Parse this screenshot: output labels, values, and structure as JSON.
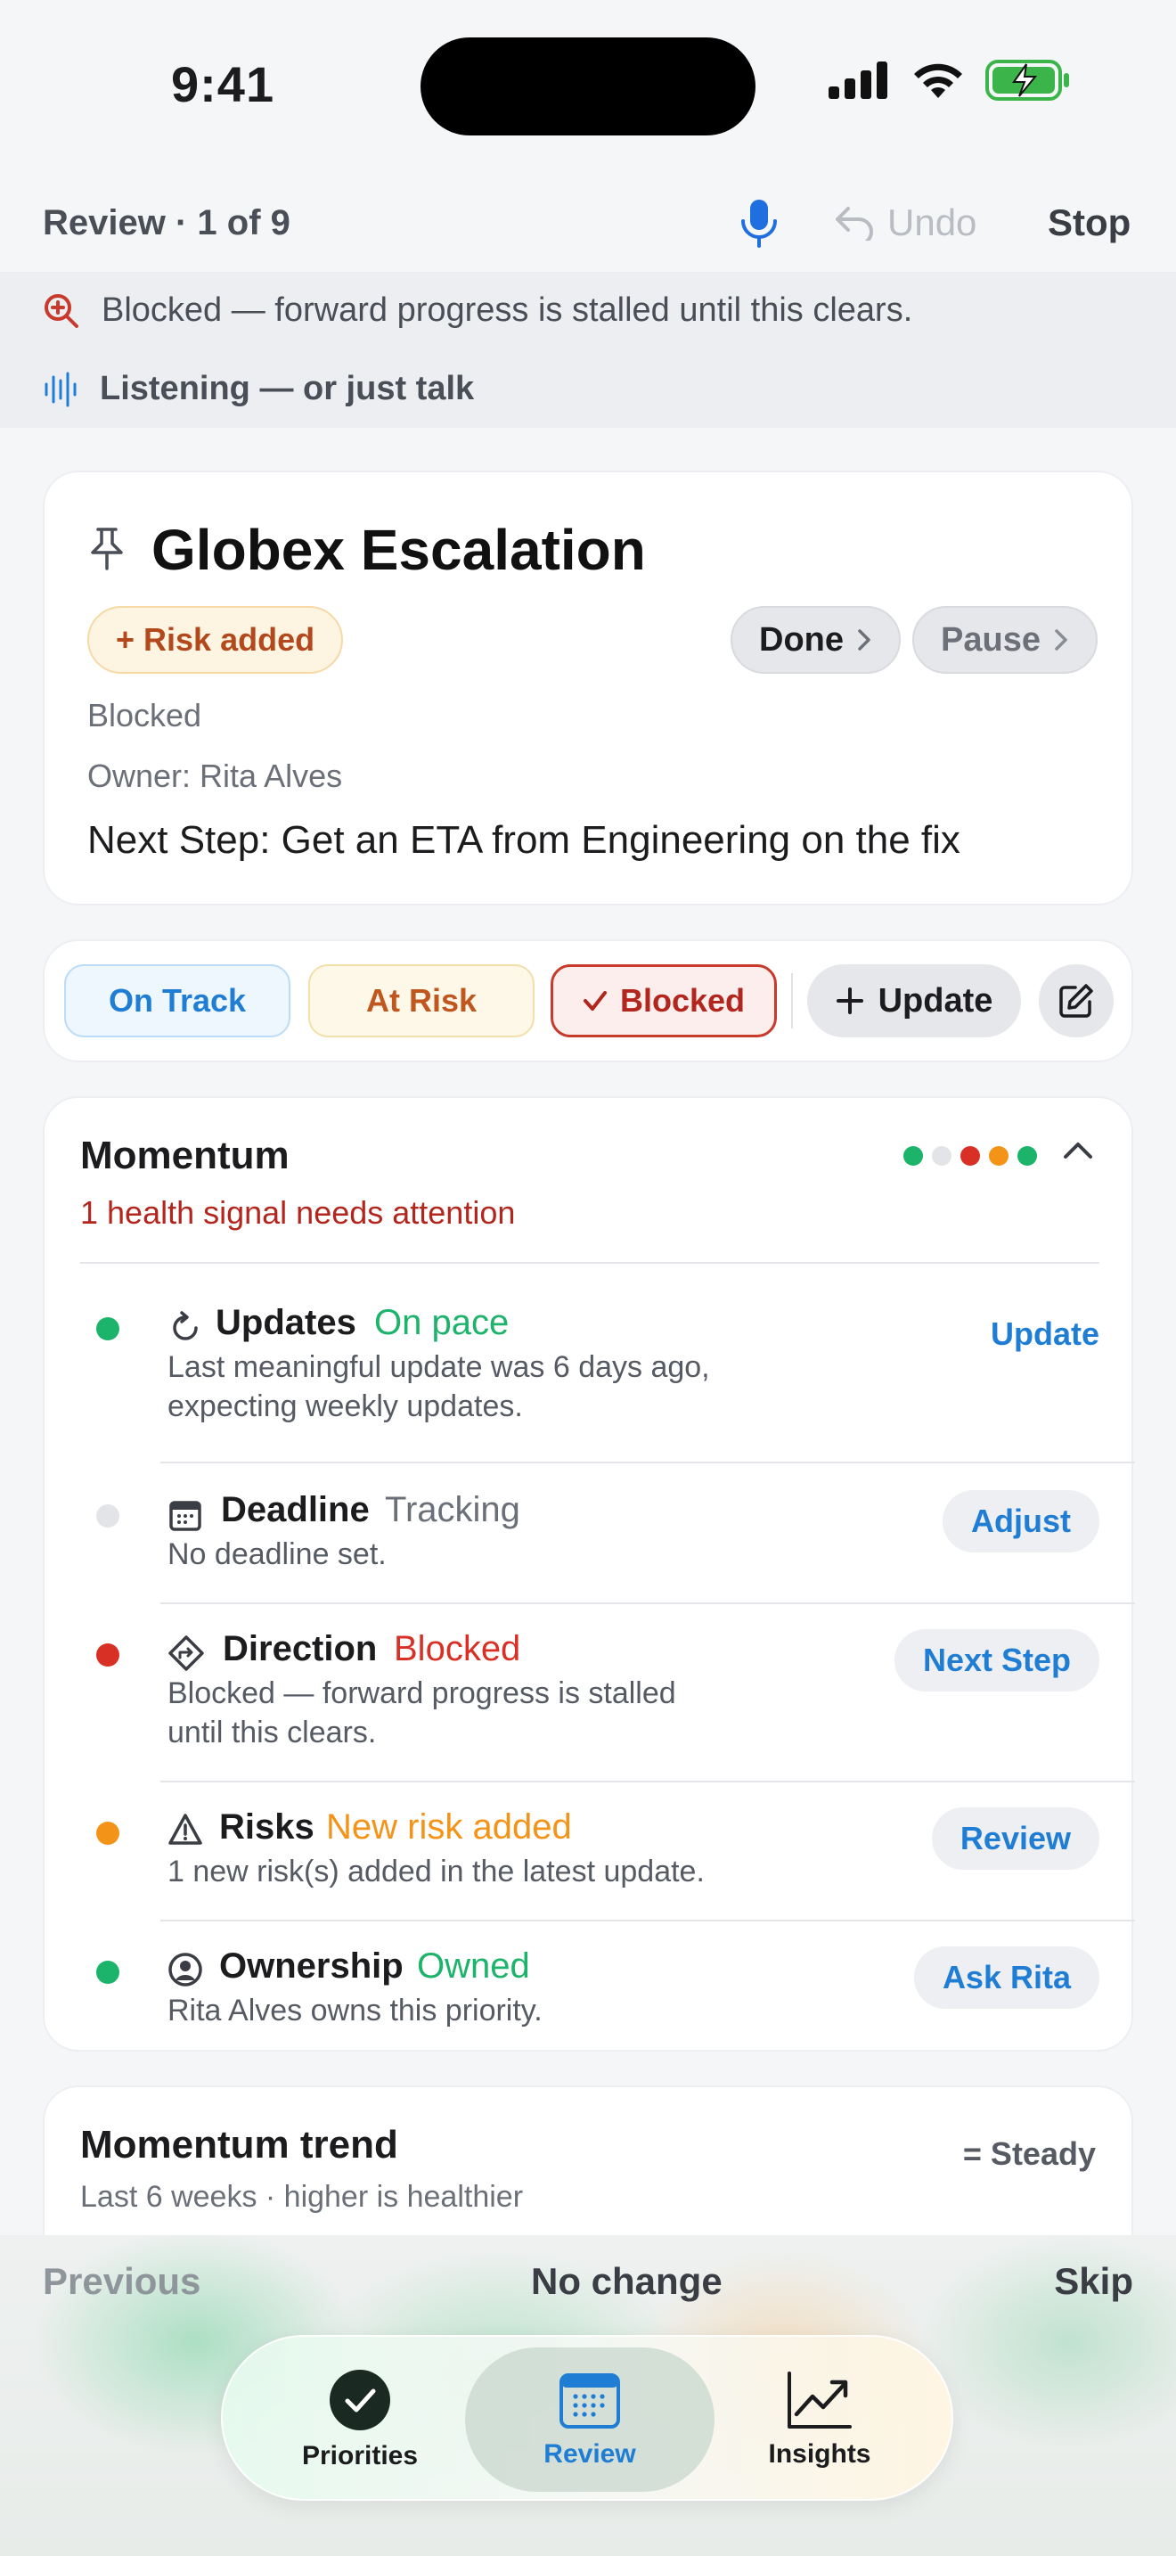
{
  "status_bar": {
    "time": "9:41"
  },
  "header": {
    "title": "Review · 1 of 9",
    "undo_label": "Undo",
    "stop_label": "Stop"
  },
  "banner": {
    "message": "Blocked — forward progress is stalled until this clears.",
    "listening": "Listening — or just talk"
  },
  "priority": {
    "title": "Globex Escalation",
    "risk_chip": "+ Risk added",
    "done_label": "Done",
    "pause_label": "Pause",
    "status": "Blocked",
    "owner": "Owner: Rita Alves",
    "next_step": "Next Step: Get an ETA from Engineering on the fix"
  },
  "status_options": {
    "on_track": "On Track",
    "at_risk": "At Risk",
    "blocked": "Blocked",
    "update": "Update",
    "selected": "Blocked"
  },
  "momentum": {
    "title": "Momentum",
    "subtitle": "1 health signal needs attention",
    "dot_colors": [
      "#1cb36b",
      "#e3e4e7",
      "#d93025",
      "#f39419",
      "#1cb36b"
    ],
    "signals": [
      {
        "name": "Updates",
        "state": "On pace",
        "state_color": "#1cb36b",
        "dot_color": "#1cb36b",
        "icon": "refresh-icon",
        "desc": "Last meaningful update was 6 days ago, expecting weekly updates.",
        "action": "Update"
      },
      {
        "name": "Deadline",
        "state": "Tracking",
        "state_color": "#6b6f78",
        "dot_color": "#e3e4e7",
        "icon": "calendar-icon",
        "desc": "No deadline set.",
        "action": "Adjust"
      },
      {
        "name": "Direction",
        "state": "Blocked",
        "state_color": "#d93025",
        "dot_color": "#d93025",
        "icon": "direction-icon",
        "desc": "Blocked — forward progress is stalled until this clears.",
        "action": "Next Step"
      },
      {
        "name": "Risks",
        "state": "New risk added",
        "state_color": "#f39419",
        "dot_color": "#f39419",
        "icon": "warning-icon",
        "desc": "1 new risk(s) added in the latest update.",
        "action": "Review"
      },
      {
        "name": "Ownership",
        "state": "Owned",
        "state_color": "#1cb36b",
        "dot_color": "#1cb36b",
        "icon": "person-icon",
        "desc": "Rita Alves owns this priority.",
        "action": "Ask Rita"
      }
    ]
  },
  "trend": {
    "title": "Momentum trend",
    "subtitle": "Last 6 weeks · higher is healthier",
    "state": "= Steady"
  },
  "review_nav": {
    "previous": "Previous",
    "no_change": "No change",
    "skip": "Skip"
  },
  "tabs": [
    {
      "label": "Priorities",
      "icon": "checkmark-circle-icon"
    },
    {
      "label": "Review",
      "icon": "calendar-grid-icon",
      "selected": true
    },
    {
      "label": "Insights",
      "icon": "trend-chart-icon"
    }
  ]
}
